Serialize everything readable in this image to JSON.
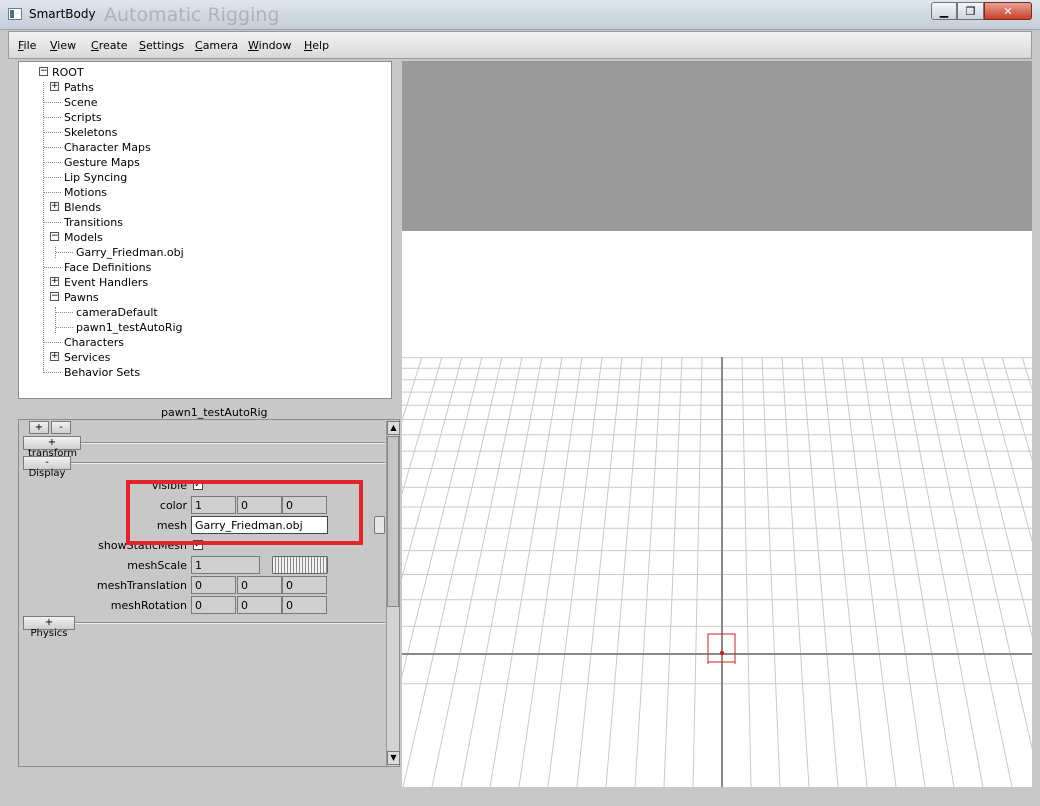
{
  "window": {
    "title": "SmartBody",
    "ghost_title": "Automatic Rigging",
    "minimize_glyph": "▁",
    "maximize_glyph": "❐",
    "close_glyph": "✕"
  },
  "menu": [
    {
      "ul": "F",
      "rest": "ile"
    },
    {
      "ul": "V",
      "rest": "iew"
    },
    {
      "ul": "C",
      "rest": "reate"
    },
    {
      "ul": "S",
      "rest": "ettings"
    },
    {
      "ul": "C",
      "rest": "amera"
    },
    {
      "ul": "W",
      "rest": "indow"
    },
    {
      "ul": "H",
      "rest": "elp"
    }
  ],
  "tree": {
    "root": "ROOT",
    "root_toggle": "−",
    "items": [
      {
        "label": "Paths",
        "toggle": "+"
      },
      {
        "label": "Scene"
      },
      {
        "label": "Scripts"
      },
      {
        "label": "Skeletons"
      },
      {
        "label": "Character Maps"
      },
      {
        "label": "Gesture Maps"
      },
      {
        "label": "Lip Syncing"
      },
      {
        "label": "Motions"
      },
      {
        "label": "Blends",
        "toggle": "+"
      },
      {
        "label": "Transitions"
      },
      {
        "label": "Models",
        "toggle": "−"
      },
      {
        "label": "Garry_Friedman.obj",
        "child": true
      },
      {
        "label": "Face Definitions"
      },
      {
        "label": "Event Handlers",
        "toggle": "+"
      },
      {
        "label": "Pawns",
        "toggle": "−"
      },
      {
        "label": "cameraDefault",
        "child": true
      },
      {
        "label": "pawn1_testAutoRig",
        "child": true
      },
      {
        "label": "Characters"
      },
      {
        "label": "Services",
        "toggle": "+"
      },
      {
        "label": "Behavior Sets"
      }
    ]
  },
  "properties": {
    "object_name": "pawn1_testAutoRig",
    "add_label": "+",
    "remove_label": "-",
    "transform_section": "+ transform",
    "display_section": "- Display",
    "physics_section": "+ Physics",
    "visible_label": "visible",
    "visible_check": "✓",
    "color_label": "color",
    "color_values": [
      "1",
      "0",
      "0"
    ],
    "mesh_label": "mesh",
    "mesh_value": "Garry_Friedman.obj",
    "show_static_label": "showStaticMesh",
    "show_static_check": "✓",
    "mesh_scale_label": "meshScale",
    "mesh_scale_value": "1",
    "mesh_translation_label": "meshTranslation",
    "mesh_translation_values": [
      "0",
      "0",
      "0"
    ],
    "mesh_rotation_label": "meshRotation",
    "mesh_rotation_values": [
      "0",
      "0",
      "0"
    ],
    "scroll_up": "▲",
    "scroll_down": "▼",
    "highlight_color": "#e3242b"
  },
  "viewport": {
    "sky_color": "#9a9a9a",
    "ground_color": "#ffffff",
    "grid_color": "#c9c9c9",
    "axis_color": "#8a8a8a",
    "marker_color": "#d21f1f"
  }
}
